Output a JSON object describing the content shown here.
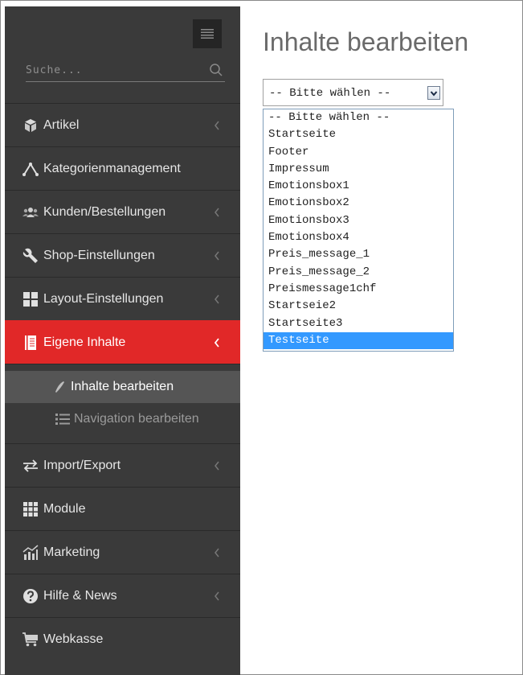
{
  "header": {
    "title": "Inhalte bearbeiten"
  },
  "search": {
    "placeholder": "Suche..."
  },
  "sidebar": {
    "items": [
      {
        "label": "Artikel",
        "icon": "cube-icon",
        "chevron": true,
        "active": false
      },
      {
        "label": "Kategorienmanagement",
        "icon": "sitemap-icon",
        "chevron": false,
        "active": false
      },
      {
        "label": "Kunden/Bestellungen",
        "icon": "users-icon",
        "chevron": true,
        "active": false
      },
      {
        "label": "Shop-Einstellungen",
        "icon": "wrench-icon",
        "chevron": true,
        "active": false
      },
      {
        "label": "Layout-Einstellungen",
        "icon": "grid-icon",
        "chevron": true,
        "active": false
      },
      {
        "label": "Eigene Inhalte",
        "icon": "book-icon",
        "chevron": true,
        "active": true
      },
      {
        "label": "Import/Export",
        "icon": "exchange-icon",
        "chevron": true,
        "active": false
      },
      {
        "label": "Module",
        "icon": "th-icon",
        "chevron": false,
        "active": false
      },
      {
        "label": "Marketing",
        "icon": "chart-icon",
        "chevron": true,
        "active": false
      },
      {
        "label": "Hilfe & News",
        "icon": "question-icon",
        "chevron": true,
        "active": false
      },
      {
        "label": "Webkasse",
        "icon": "cart-icon",
        "chevron": false,
        "active": false
      }
    ],
    "submenu": [
      {
        "label": "Inhalte bearbeiten",
        "icon": "pen-icon",
        "active": true
      },
      {
        "label": "Navigation bearbeiten",
        "icon": "list-icon",
        "active": false
      }
    ]
  },
  "select": {
    "value": "-- Bitte wählen --",
    "options": [
      "-- Bitte wählen --",
      "Startseite",
      "Footer",
      "Impressum",
      "Emotionsbox1",
      "Emotionsbox2",
      "Emotionsbox3",
      "Emotionsbox4",
      "Preis_message_1",
      "Preis_message_2",
      "Preismessage1chf",
      "Startseie2",
      "Startseite3",
      "Testseite"
    ],
    "highlighted": "Testseite"
  },
  "colors": {
    "sidebar": "#3a3a3a",
    "active": "#e12828",
    "highlight": "#3399ff"
  }
}
